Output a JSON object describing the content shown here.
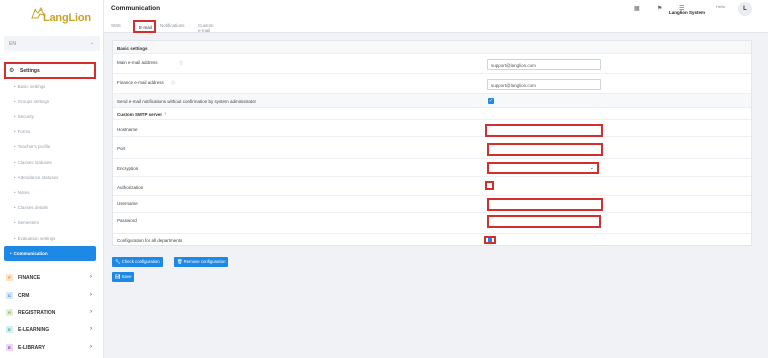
{
  "brand": {
    "name": "LangLion"
  },
  "sidebar": {
    "language": "EN",
    "settings_label": "Settings",
    "sub_items": [
      "Basic settings",
      "Groups settings",
      "Security",
      "Forms",
      "Teacher's profile",
      "Classes statuses",
      "Attendance statuses",
      "Notes",
      "Classes details",
      "Semesters",
      "Evaluation settings"
    ],
    "active_sub": "Communication",
    "modules": [
      {
        "badge": "F",
        "label": "FINANCE",
        "color": "#f57c00",
        "bg": "#fde3c9"
      },
      {
        "badge": "C",
        "label": "CRM",
        "color": "#1976d2",
        "bg": "#d6e6f7"
      },
      {
        "badge": "R",
        "label": "REGISTRATION",
        "color": "#7cb342",
        "bg": "#e4f0d6"
      },
      {
        "badge": "E",
        "label": "E-LEARNING",
        "color": "#26a69a",
        "bg": "#d2efec"
      },
      {
        "badge": "E",
        "label": "E-LIBRARY",
        "color": "#8e24aa",
        "bg": "#ecd7f1"
      }
    ]
  },
  "header": {
    "title": "Communication",
    "tabs": [
      "SMS",
      "E-mail",
      "Notifications",
      "Custom e-mail"
    ],
    "active_tab": "E-mail",
    "hello": "Hello",
    "user": "Langlion System",
    "avatar": "L"
  },
  "form": {
    "basic_settings": "Basic settings",
    "main_email_label": "Main e-mail address",
    "main_email_value": "support@langlion.com",
    "finance_email_label": "Finance e-mail address",
    "finance_email_value": "support@langlion.com",
    "send_label": "Send e-mail notifications without confirmation by system administrator",
    "smtp_title": "Custom SMTP server",
    "hostname_label": "Hostname",
    "port_label": "Port",
    "encryption_label": "Encryption",
    "authorization_label": "Authorization",
    "username_label": "Username",
    "password_label": "Password",
    "config_label": "Configuration for all departments"
  },
  "buttons": {
    "check": "Check configuration",
    "remove": "Remove configuration",
    "save": "Save"
  },
  "colors": {
    "accent": "#1e88e5",
    "highlight": "#d32f2f",
    "brand": "#c9a227"
  }
}
